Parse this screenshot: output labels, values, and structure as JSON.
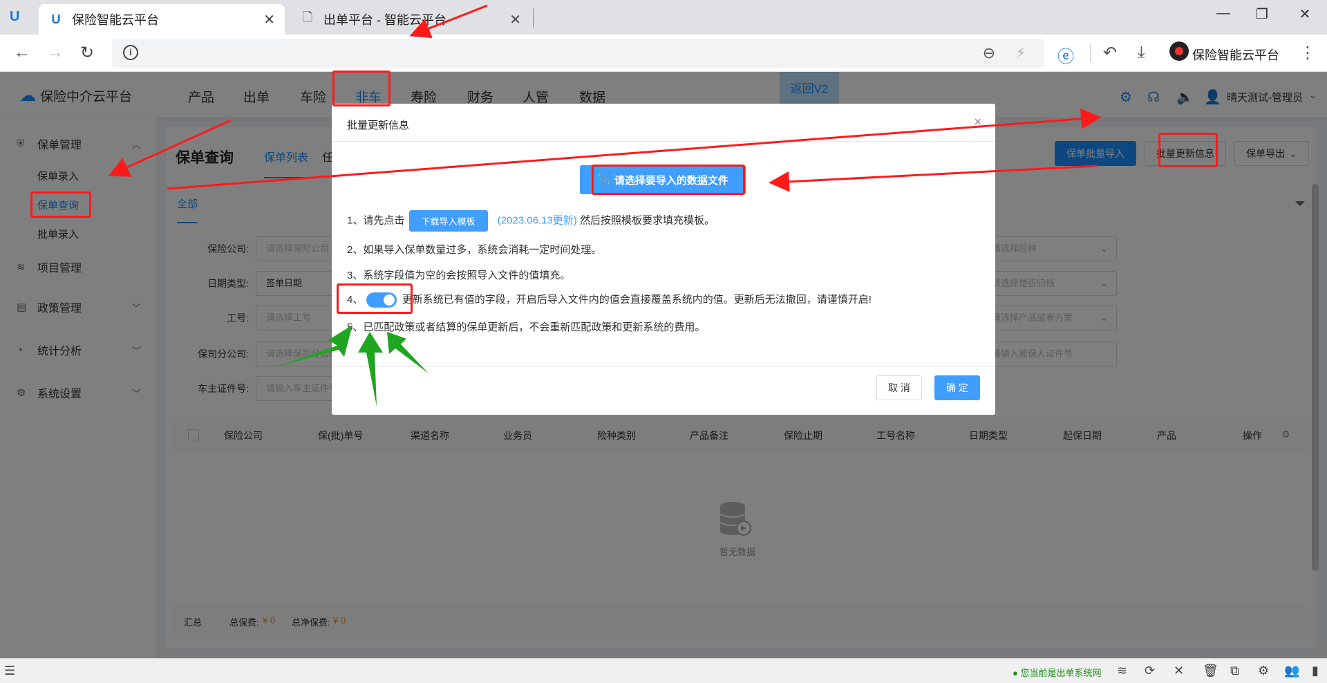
{
  "browser": {
    "tabs": [
      {
        "title": "保险智能云平台",
        "active": true
      },
      {
        "title": "出单平台 - 智能云平台",
        "active": false
      }
    ],
    "profile_name": "保险智能云平台",
    "status_text": "您当前是出单系统网"
  },
  "app": {
    "brand": "保险中介云平台",
    "nav": [
      "产品",
      "出单",
      "车险",
      "非车",
      "寿险",
      "财务",
      "人管",
      "数据"
    ],
    "nav_active": "非车",
    "return_label": "返回V2",
    "user_label": "晴天测试-管理员"
  },
  "sidebar": {
    "groups": [
      {
        "label": "保单管理",
        "icon": "shield-icon"
      },
      {
        "label": "项目管理",
        "icon": "layers-icon"
      },
      {
        "label": "政策管理",
        "icon": "policy-icon"
      },
      {
        "label": "统计分析",
        "icon": "chart-icon"
      },
      {
        "label": "系统设置",
        "icon": "gear-icon"
      }
    ],
    "sub_items": [
      "保单录入",
      "保单查询",
      "批单录入"
    ],
    "active_sub": "保单查询"
  },
  "page": {
    "title": "保单查询",
    "tabs": [
      "保单列表",
      "任"
    ],
    "buttons": {
      "batch_import": "保单批量导入",
      "batch_update": "批量更新信息",
      "export": "保单导出"
    },
    "sub_tab": "全部",
    "form": {
      "labels": [
        "保险公司:",
        "日期类型:",
        "工号:",
        "保司分公司:",
        "车主证件号:"
      ],
      "inputs": [
        "请选择保险公司",
        "签单日期",
        "请选择工号",
        "请选择保司分公司",
        "请输入车主证件号"
      ],
      "right_inputs": [
        "请选择险种",
        "请选择是否归档",
        "请选择产品或者方案",
        "请输入被保人证件号"
      ]
    },
    "table_headers": [
      "保险公司",
      "保(批)单号",
      "渠道名称",
      "业务员",
      "险种类别",
      "产品备注",
      "保险止期",
      "工号名称",
      "日期类型",
      "起保日期",
      "产品",
      "操作"
    ],
    "empty_text": "暂无数据",
    "summary": {
      "label": "汇总",
      "premium_label": "总保费:",
      "premium_value": "¥ 0",
      "net_label": "总净保费:",
      "net_value": "¥ 0"
    }
  },
  "modal": {
    "title": "批量更新信息",
    "upload_label": "请选择要导入的数据文件",
    "line1_prefix": "1、请先点击",
    "download_label": "下载导入模板",
    "line1_date": "(2023.06.13更新)",
    "line1_suffix": "然后按照模板要求填充模板。",
    "line2": "2、如果导入保单数量过多，系统会消耗一定时间处理。",
    "line3": "3、系统字段值为空的会按照导入文件的值填充。",
    "line4_prefix": "4、",
    "line4_text": "更新系统已有值的字段，开启后导入文件内的值会直接覆盖系统内的值。更新后无法撤回，请谨慎开启!",
    "line4_toggle_on": true,
    "line5": "5、已匹配政策或者结算的保单更新后，不会重新匹配政策和更新系统的费用。",
    "cancel_label": "取 消",
    "ok_label": "确 定"
  },
  "colors": {
    "primary": "#1890ff",
    "annotation": "#ff1a1a",
    "arrow_green": "#1fa51f"
  }
}
